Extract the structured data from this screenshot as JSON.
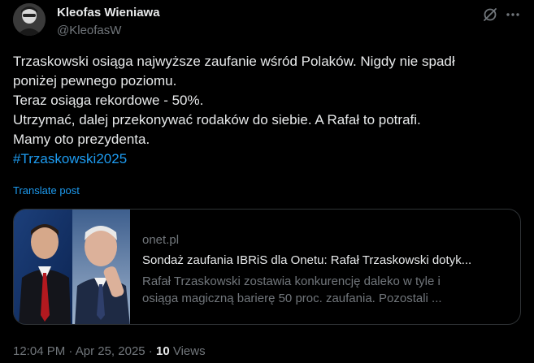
{
  "author": {
    "name": "Kleofas Wieniawa",
    "handle": "@KleofasW"
  },
  "header_icons": {
    "grok": "grok-icon",
    "more": "more-dots-icon"
  },
  "tweet": {
    "lines": [
      "Trzaskowski osiąga najwyższe zaufanie wśród Polaków. Nigdy nie spadł",
      "poniżej pewnego poziomu.",
      "Teraz osiąga rekordowe - 50%.",
      "Utrzymać, dalej przekonywać rodaków do siebie. A Rafał to potrafi.",
      "Mamy oto prezydenta."
    ],
    "hashtag": "#Trzaskowski2025",
    "translate_label": "Translate post"
  },
  "card": {
    "domain": "onet.pl",
    "title": "Sondaż zaufania IBRiS dla Onetu: Rafał Trzaskowski dotyk...",
    "description_lines": [
      "Rafał Trzaskowski zostawia konkurencję daleko w tyle i",
      "osiąga magiczną barierę 50 proc. zaufania. Pozostali ..."
    ]
  },
  "meta": {
    "time": "12:04 PM",
    "separator": " · ",
    "date": "Apr 25, 2025",
    "separator2": " · ",
    "views_count": "10",
    "views_label": " Views"
  },
  "colors": {
    "background": "#000000",
    "text": "#e7e9ea",
    "muted": "#71767b",
    "link": "#1d9bf0",
    "border": "#2f3336"
  }
}
